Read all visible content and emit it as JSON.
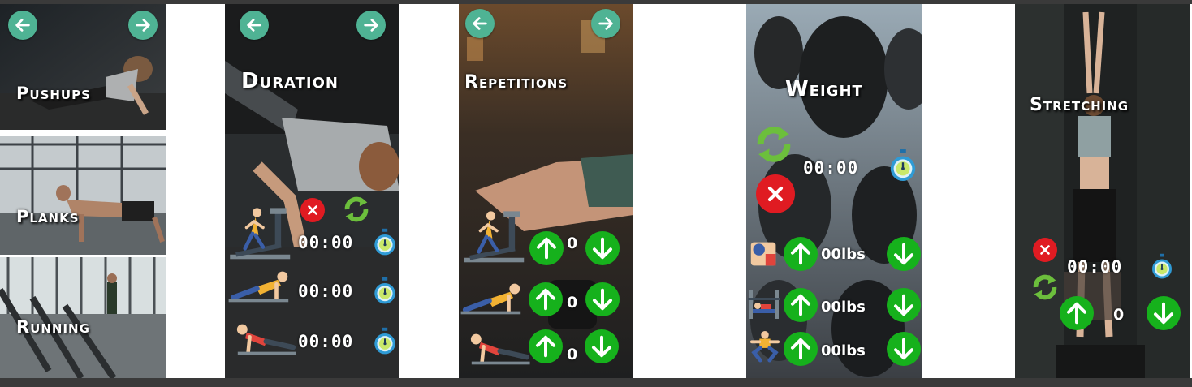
{
  "categories": {
    "pushups": "Pushups",
    "planks": "Planks",
    "running": "Running"
  },
  "duration": {
    "title": "Duration",
    "rows": [
      {
        "exercise_icon": "treadmill-runner-icon",
        "time": "00:00"
      },
      {
        "exercise_icon": "plank-icon",
        "time": "00:00"
      },
      {
        "exercise_icon": "pushup-icon",
        "time": "00:00"
      }
    ]
  },
  "repetitions": {
    "title": "Repetitions",
    "rows": [
      {
        "exercise_icon": "treadmill-runner-icon",
        "count": "0"
      },
      {
        "exercise_icon": "plank-icon",
        "count": "0"
      },
      {
        "exercise_icon": "pushup-icon",
        "count": "0"
      }
    ]
  },
  "weight": {
    "title": "Weight",
    "time": "00:00",
    "rows": [
      {
        "exercise_icon": "bicep-curl-icon",
        "value": "00lbs"
      },
      {
        "exercise_icon": "bench-press-icon",
        "value": "00lbs"
      },
      {
        "exercise_icon": "squat-icon",
        "value": "00lbs"
      }
    ]
  },
  "stretching": {
    "title": "Stretching",
    "time": "00:00",
    "count": "0"
  },
  "icons": {
    "left_arrow": "arrow-left-icon",
    "right_arrow": "arrow-right-icon",
    "up": "arrow-up-icon",
    "down": "arrow-down-icon",
    "reset": "refresh-icon",
    "close": "close-icon",
    "timer": "stopwatch-icon"
  },
  "colors": {
    "nav_button": "#4fb394",
    "arrow_button": "#16b11c",
    "close_button": "#e01b22",
    "reset_icon": "#6cbf3c",
    "timer_ring": "#2f9bd6",
    "timer_face": "#c9e86a"
  }
}
